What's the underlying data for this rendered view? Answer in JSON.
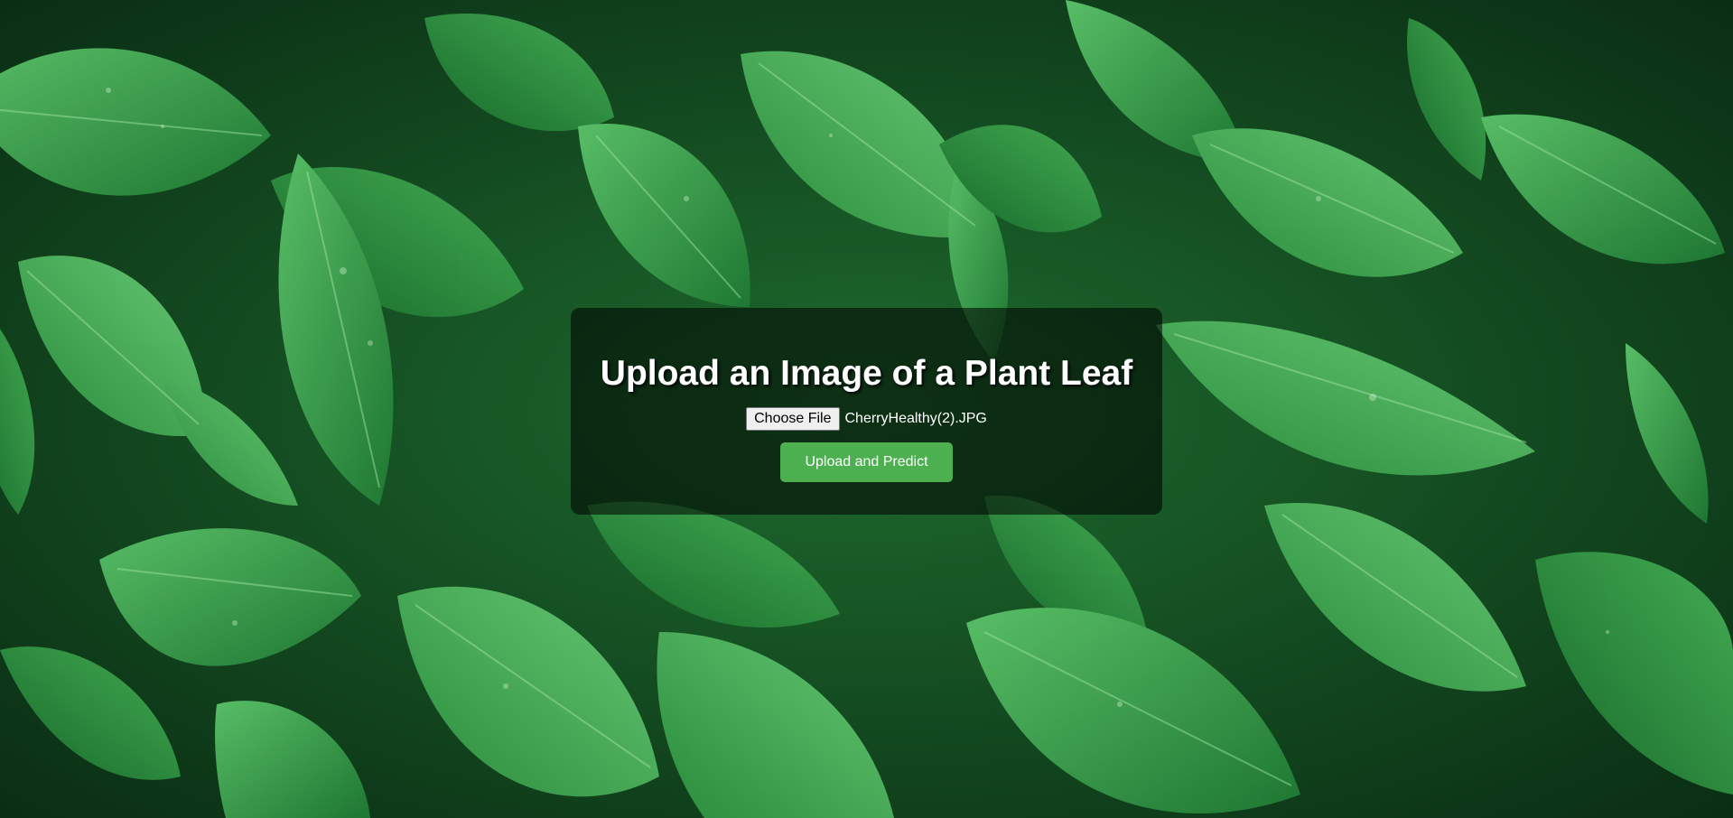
{
  "page": {
    "title": "Upload an Image of a Plant Leaf"
  },
  "form": {
    "choose_file_label": "Choose File",
    "selected_file_name": "CherryHealthy(2).JPG",
    "submit_label": "Upload and Predict"
  },
  "background": {
    "icon": "leaves-photo"
  },
  "colors": {
    "accent": "#4caf50",
    "overlay": "rgba(0,0,0,0.55)",
    "leaf_dark": "#0d3a1a",
    "leaf_mid": "#2e8b3e",
    "leaf_light": "#4cba5a"
  }
}
